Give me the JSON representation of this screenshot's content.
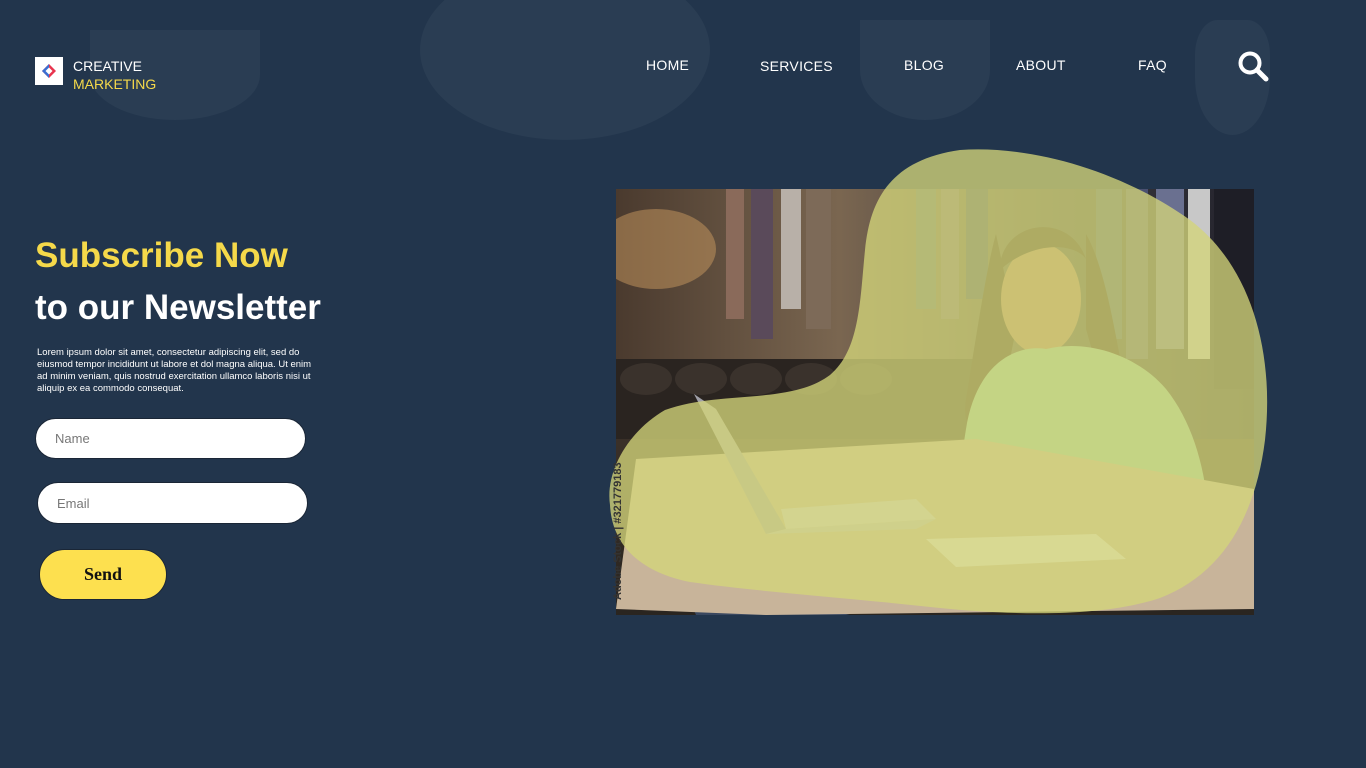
{
  "brand": {
    "line1": "CREATIVE",
    "line2": "MARKETING"
  },
  "nav": {
    "items": [
      {
        "label": "HOME"
      },
      {
        "label": "SERVICES"
      },
      {
        "label": "BLOG"
      },
      {
        "label": "ABOUT"
      },
      {
        "label": "FAQ"
      }
    ],
    "search_icon": "search-icon"
  },
  "hero": {
    "title_highlight": "Subscribe Now",
    "title_rest": "to our Newsletter",
    "body": "Lorem ipsum dolor sit amet, consectetur adipiscing elit, sed do eiusmod tempor incididunt ut labore et dol magna aliqua. Ut enim ad minim veniam, quis nostrud exercitation ullamco laboris nisi ut aliquip ex ea commodo consequat."
  },
  "form": {
    "name_placeholder": "Name",
    "email_placeholder": "Email",
    "send_label": "Send"
  },
  "image": {
    "watermark": "Adobe Stock | #321779183"
  },
  "colors": {
    "background": "#22354c",
    "accent": "#f5d94a",
    "button": "#fde04f",
    "overlay": "#d4d57a"
  }
}
